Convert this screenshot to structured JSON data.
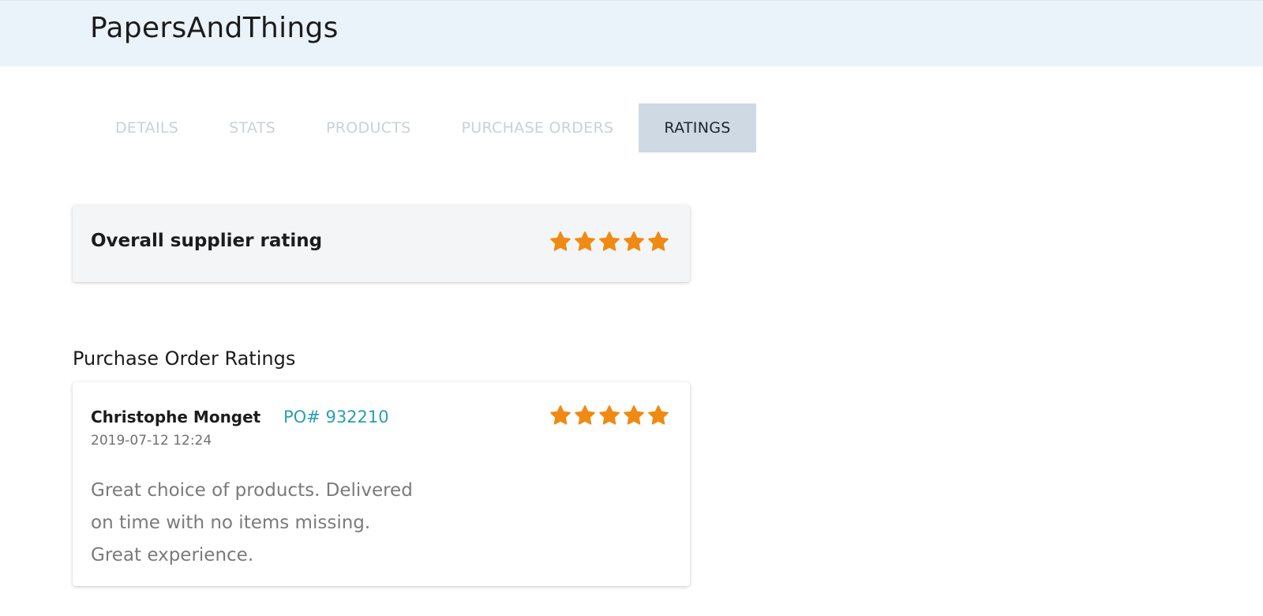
{
  "header": {
    "app_title": "PapersAndThings"
  },
  "tabs": [
    {
      "label": "DETAILS",
      "active": false
    },
    {
      "label": "STATS",
      "active": false
    },
    {
      "label": "PRODUCTS",
      "active": false
    },
    {
      "label": "PURCHASE ORDERS",
      "active": false
    },
    {
      "label": "RATINGS",
      "active": true
    }
  ],
  "overall": {
    "label": "Overall supplier rating",
    "rating": 5,
    "max_rating": 5,
    "icon": "star-icon"
  },
  "purchase_order_ratings": {
    "section_title": "Purchase Order Ratings",
    "items": [
      {
        "reviewer": "Christophe Monget",
        "po_label": "PO# 932210",
        "timestamp": "2019-07-12 12:24",
        "rating": 5,
        "max_rating": 5,
        "comment": "Great choice of products. Delivered on time with no items missing. Great experience."
      }
    ]
  },
  "colors": {
    "header_bg": "#ebf3fa",
    "active_tab_bg": "#cfd9e4",
    "inactive_tab_text": "#c9d1da",
    "star": "#f08a12",
    "link": "#2a9fb0",
    "card_bg_overall": "#f4f5f6"
  }
}
